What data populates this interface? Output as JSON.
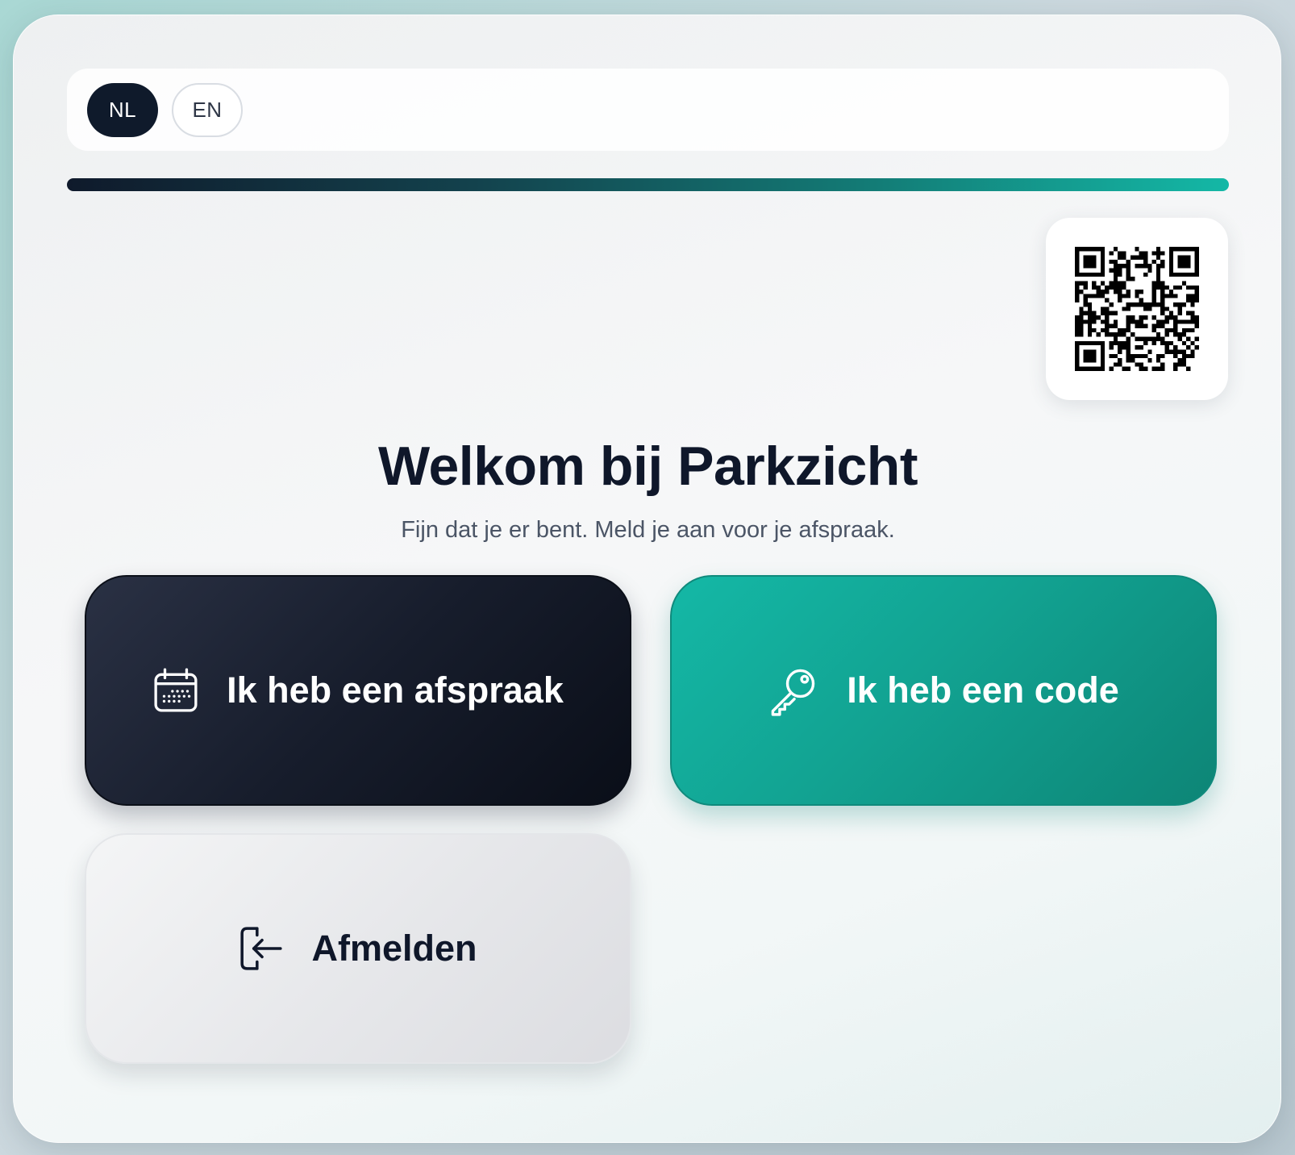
{
  "language": {
    "options": [
      {
        "code": "NL",
        "active": true
      },
      {
        "code": "EN",
        "active": false
      }
    ]
  },
  "progress": {
    "fraction": 1.0
  },
  "qr": {
    "icon": "qr-code-icon"
  },
  "welcome": {
    "title": "Welkom bij Parkzicht",
    "subtitle": "Fijn dat je er bent. Meld je aan voor je afspraak."
  },
  "actions": {
    "appointment": {
      "label": "Ik heb een afspraak",
      "icon": "calendar-icon"
    },
    "code": {
      "label": "Ik heb een code",
      "icon": "key-icon"
    },
    "checkout": {
      "label": "Afmelden",
      "icon": "sign-out-icon"
    }
  },
  "colors": {
    "dark": "#0f1a2b",
    "accent": "#14b8a6",
    "accent_dark": "#0d8576",
    "text": "#0f172a",
    "muted": "#4b5566"
  }
}
